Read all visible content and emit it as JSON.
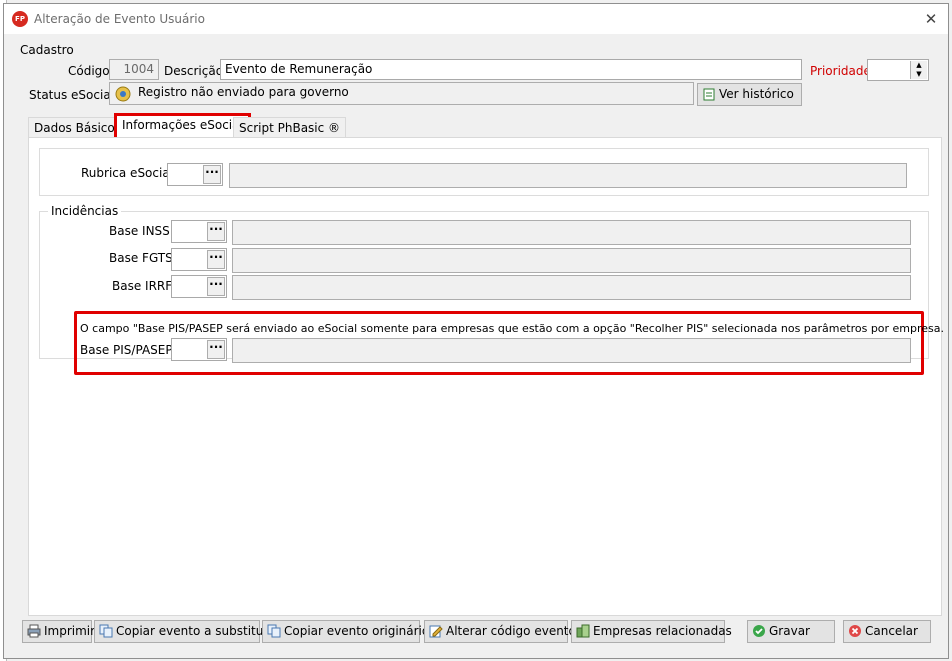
{
  "window": {
    "title": "Alteração de Evento Usuário",
    "app_icon": "FP"
  },
  "cadastro": {
    "group_label": "Cadastro",
    "codigo_label": "Código",
    "codigo_value": "1004",
    "descricao_label": "Descrição",
    "descricao_value": "Evento de Remuneração",
    "prioridade_label": "Prioridade",
    "prioridade_value": "",
    "status_label": "Status eSocial",
    "status_value": "Registro não enviado para governo",
    "ver_historico": "Ver histórico"
  },
  "tabs": [
    {
      "label": "Dados Básicos"
    },
    {
      "label": "Informações eSocial"
    },
    {
      "label": "Script PhBasic ®"
    }
  ],
  "esocial": {
    "rubrica_label": "Rubrica eSocial",
    "incidencias_label": "Incidências",
    "inss_label": "Base INSS:",
    "fgts_label": "Base FGTS:",
    "irrf_label": "Base IRRF:",
    "pis_note": "O campo \"Base PIS/PASEP será enviado ao eSocial somente para empresas que estão com a opção \"Recolher PIS\" selecionada nos parâmetros por empresa.",
    "pis_label": "Base PIS/PASEP:",
    "dots": "···"
  },
  "footer": {
    "imprimir": "Imprimir",
    "copiar_substituir": "Copiar evento a substituir",
    "copiar_originario": "Copiar evento originário",
    "alterar_codigo": "Alterar código evento",
    "empresas": "Empresas relacionadas",
    "gravar": "Gravar",
    "cancelar": "Cancelar"
  },
  "colors": {
    "accent_red": "#e00000",
    "prioridade_red": "#d00000"
  }
}
